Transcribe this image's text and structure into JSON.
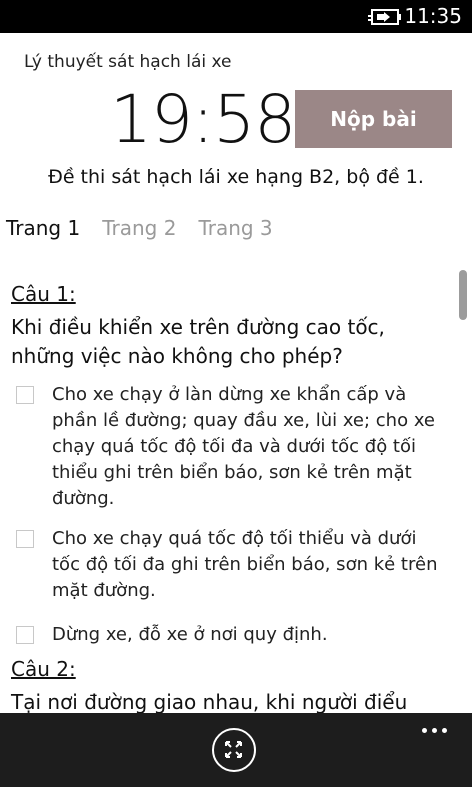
{
  "status_bar": {
    "time": "11:35",
    "battery_icon": "battery-charging-icon"
  },
  "header": {
    "app_title": "Lý thuyết sát hạch lái xe",
    "timer": "19:58",
    "submit_label": "Nộp bài",
    "submit_color": "#9b8787",
    "exam_title": "Đề thi sát hạch lái xe hạng B2, bộ đề 1."
  },
  "tabs": [
    {
      "label": "Trang 1",
      "active": true
    },
    {
      "label": "Trang 2",
      "active": false
    },
    {
      "label": "Trang 3",
      "active": false
    }
  ],
  "questions": [
    {
      "label": "Câu 1:",
      "text": "Khi điều khiển xe trên đường cao tốc, những việc nào không cho phép?",
      "options": [
        "Cho xe chạy ở làn dừng xe khẩn cấp và phần lề đường; quay đầu xe, lùi xe; cho xe chạy quá tốc độ tối đa và dưới tốc độ tối thiểu ghi trên biển báo, sơn kẻ trên mặt đường.",
        "Cho xe chạy quá tốc độ tối thiểu và dưới tốc độ tối đa ghi trên biển báo, sơn kẻ trên mặt đường.",
        "Dừng xe, đỗ xe ở nơi quy định."
      ]
    },
    {
      "label": "Câu 2:",
      "text": "Tại nơi đường giao nhau, khi người điểu",
      "options": []
    }
  ],
  "app_bar": {
    "fullscreen_icon": "fullscreen-icon",
    "more_icon": "more-icon"
  }
}
